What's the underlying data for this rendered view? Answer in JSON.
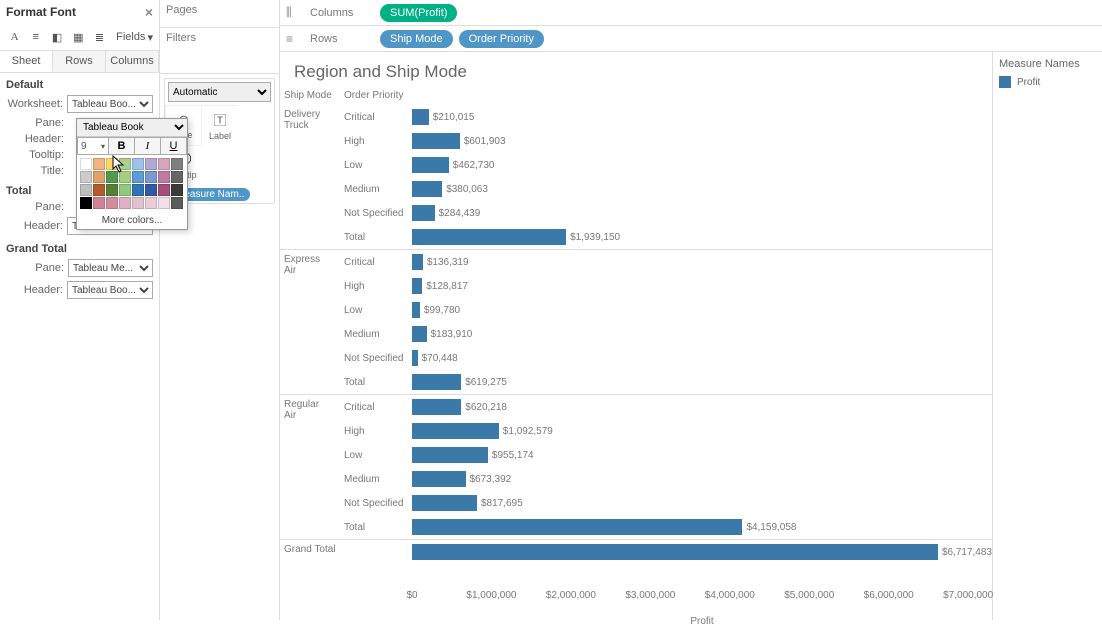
{
  "format_panel": {
    "title": "Format Font",
    "fields_label": "Fields",
    "tabs": [
      "Sheet",
      "Rows",
      "Columns"
    ],
    "section_default": "Default",
    "section_total": "Total",
    "section_grand_total": "Grand Total",
    "labels": {
      "worksheet": "Worksheet:",
      "pane": "Pane:",
      "header": "Header:",
      "tooltip": "Tooltip:",
      "title": "Title:"
    },
    "font_options": {
      "tableau_book": "Tableau Boo...",
      "tableau_book_full": "Tableau Book",
      "tableau_me": "Tableau Me..."
    },
    "popup": {
      "font_family": "Tableau Book",
      "font_size": "9",
      "more_colors": "More colors...",
      "colors": [
        "#ffffff",
        "#f4b183",
        "#ffd966",
        "#a9d18e",
        "#9dc3e6",
        "#b4a7d6",
        "#d5a6bd",
        "#7f7f7f",
        "#cccccc",
        "#e2a26a",
        "#4e9a4e",
        "#a4d07e",
        "#5c9bd5",
        "#7a99d1",
        "#c27ba0",
        "#666666",
        "#bfbfbf",
        "#b45a2e",
        "#548235",
        "#8fc97a",
        "#2e75b6",
        "#315aa6",
        "#a64d79",
        "#3b3b3b",
        "#000000",
        "#ce8496",
        "#d48ba0",
        "#ddb0c2",
        "#e2c1cf",
        "#eacdd6",
        "#f2e0e6",
        "#5b5b5b"
      ]
    }
  },
  "mid": {
    "pages": "Pages",
    "filters": "Filters",
    "marks_auto": "Automatic",
    "size": "Size",
    "label": "Label",
    "tooltip": "Tooltip",
    "measure_names": "Measure Nam.."
  },
  "shelves": {
    "columns_label": "Columns",
    "rows_label": "Rows",
    "columns_pill": "SUM(Profit)",
    "rows_pills": [
      "Ship Mode",
      "Order Priority"
    ]
  },
  "chart": {
    "title": "Region and Ship Mode",
    "col_header1": "Ship Mode",
    "col_header2": "Order Priority",
    "axis_label": "Profit",
    "legend_title": "Measure Names",
    "legend_item": "Profit",
    "grand_total_label": "Grand Total",
    "axis_ticks": [
      "$0",
      "$1,000,000",
      "$2,000,000",
      "$3,000,000",
      "$4,000,000",
      "$5,000,000",
      "$6,000,000",
      "$7,000,000"
    ]
  },
  "chart_data": {
    "type": "bar",
    "xlabel": "Profit",
    "x_max": 7300000,
    "groups": [
      {
        "name": "Delivery Truck",
        "rows": [
          {
            "label": "Critical",
            "value": 210015,
            "text": "$210,015"
          },
          {
            "label": "High",
            "value": 601903,
            "text": "$601,903"
          },
          {
            "label": "Low",
            "value": 462730,
            "text": "$462,730"
          },
          {
            "label": "Medium",
            "value": 380063,
            "text": "$380,063"
          },
          {
            "label": "Not Specified",
            "value": 284439,
            "text": "$284,439"
          },
          {
            "label": "Total",
            "value": 1939150,
            "text": "$1,939,150"
          }
        ]
      },
      {
        "name": "Express Air",
        "rows": [
          {
            "label": "Critical",
            "value": 136319,
            "text": "$136,319"
          },
          {
            "label": "High",
            "value": 128817,
            "text": "$128,817"
          },
          {
            "label": "Low",
            "value": 99780,
            "text": "$99,780"
          },
          {
            "label": "Medium",
            "value": 183910,
            "text": "$183,910"
          },
          {
            "label": "Not Specified",
            "value": 70448,
            "text": "$70,448"
          },
          {
            "label": "Total",
            "value": 619275,
            "text": "$619,275"
          }
        ]
      },
      {
        "name": "Regular Air",
        "rows": [
          {
            "label": "Critical",
            "value": 620218,
            "text": "$620,218"
          },
          {
            "label": "High",
            "value": 1092579,
            "text": "$1,092,579"
          },
          {
            "label": "Low",
            "value": 955174,
            "text": "$955,174"
          },
          {
            "label": "Medium",
            "value": 673392,
            "text": "$673,392"
          },
          {
            "label": "Not Specified",
            "value": 817695,
            "text": "$817,695"
          },
          {
            "label": "Total",
            "value": 4159058,
            "text": "$4,159,058"
          }
        ]
      }
    ],
    "grand_total": {
      "label": "Grand Total",
      "value": 6717483,
      "text": "$6,717,483"
    }
  }
}
